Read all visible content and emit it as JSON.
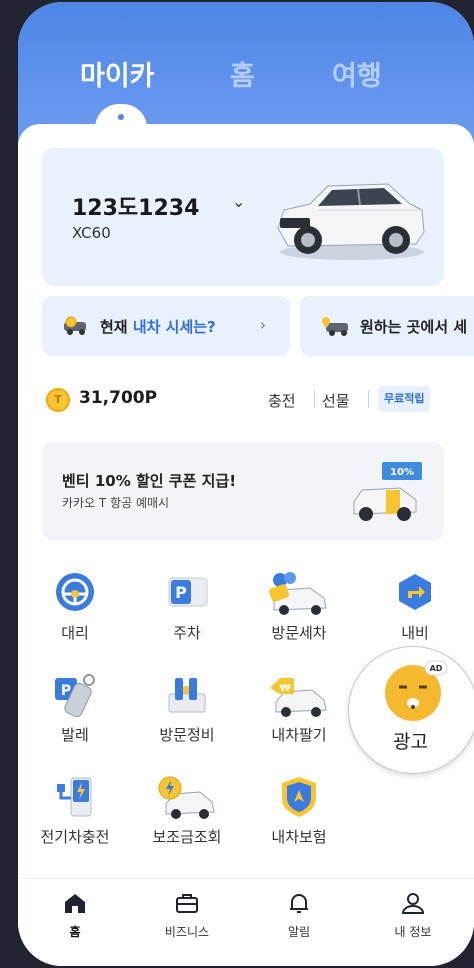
{
  "top_tabs": [
    {
      "label": "마이카",
      "active": true
    },
    {
      "label": "홈",
      "active": false
    },
    {
      "label": "여행",
      "active": false
    }
  ],
  "car": {
    "plate": "123도1234",
    "chevron": "⌄",
    "model": "XC60",
    "image": "white-suv-image"
  },
  "chips": [
    {
      "icon": "car-coin-icon",
      "prefix": "현재 ",
      "highlight": "내차 시세는?",
      "arrow": "›"
    },
    {
      "icon": "car-location-icon",
      "text": "원하는 곳에서 세"
    }
  ],
  "points": {
    "coin_glyph": "T",
    "value": "31,700P",
    "charge": "충전",
    "gift": "선물",
    "free_badge": "무료적립"
  },
  "promo": {
    "title": "벤티 10% 할인 쿠폰 지급!",
    "subtitle": "카카오 T 항공 예매시",
    "coupon_text": "10%"
  },
  "services": [
    {
      "label": "대리",
      "icon": "steering-wheel-icon"
    },
    {
      "label": "주차",
      "icon": "parking-ticket-icon"
    },
    {
      "label": "방문세차",
      "icon": "car-wash-icon"
    },
    {
      "label": "내비",
      "icon": "navigation-icon"
    },
    {
      "label": "발레",
      "icon": "valet-key-icon"
    },
    {
      "label": "방문정비",
      "icon": "toolbox-icon"
    },
    {
      "label": "내차팔기",
      "icon": "car-sell-icon"
    },
    {
      "label": "전기차충전",
      "icon": "ev-charger-icon"
    },
    {
      "label": "보조금조회",
      "icon": "subsidy-car-icon"
    },
    {
      "label": "내차보험",
      "icon": "insurance-shield-icon"
    }
  ],
  "ad": {
    "label": "광고",
    "badge": "AD",
    "icon": "character-face-icon"
  },
  "bottom_nav": [
    {
      "label": "홈",
      "icon": "home-icon",
      "active": true
    },
    {
      "label": "비즈니스",
      "icon": "briefcase-icon",
      "active": false
    },
    {
      "label": "알림",
      "icon": "bell-icon",
      "active": false
    },
    {
      "label": "내 정보",
      "icon": "person-icon",
      "active": false
    }
  ],
  "colors": {
    "brand_blue": "#4d86e6",
    "highlight": "#2f6fe0",
    "card_bg": "#e9f2fc",
    "coin": "#f7c531"
  }
}
